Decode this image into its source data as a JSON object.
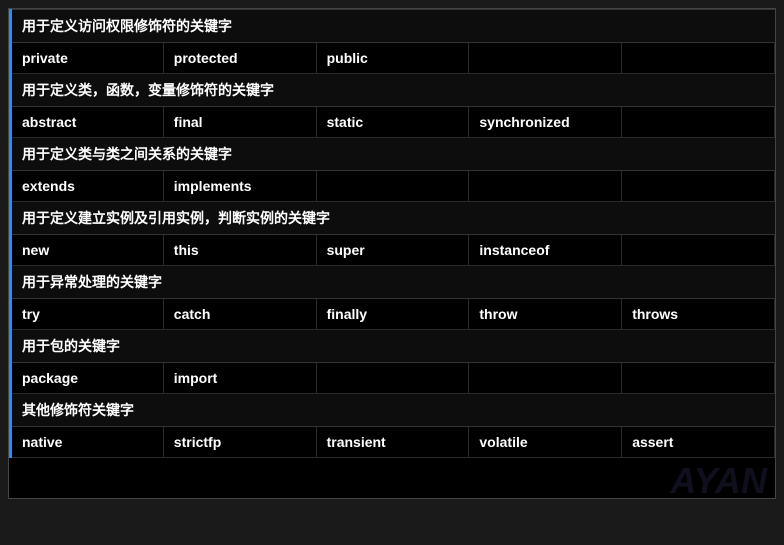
{
  "sections": [
    {
      "header": "用于定义访问权限修饰符的关键字",
      "keywords": [
        "private",
        "protected",
        "public",
        "",
        ""
      ]
    },
    {
      "header": "用于定义类，函数，变量修饰符的关键字",
      "keywords": [
        "abstract",
        "final",
        "static",
        "synchronized",
        ""
      ]
    },
    {
      "header": "用于定义类与类之间关系的关键字",
      "keywords": [
        "extends",
        "implements",
        "",
        "",
        ""
      ]
    },
    {
      "header": "用于定义建立实例及引用实例，判断实例的关键字",
      "keywords": [
        "new",
        "this",
        "super",
        "instanceof",
        ""
      ]
    },
    {
      "header": "用于异常处理的关键字",
      "keywords": [
        "try",
        "catch",
        "finally",
        "throw",
        "throws"
      ]
    },
    {
      "header": "用于包的关键字",
      "keywords": [
        "package",
        "import",
        "",
        "",
        ""
      ]
    },
    {
      "header": "其他修饰符关键字",
      "keywords": [
        "native",
        "strictfp",
        "transient",
        "volatile",
        "assert"
      ]
    }
  ],
  "watermark": "AYAN"
}
